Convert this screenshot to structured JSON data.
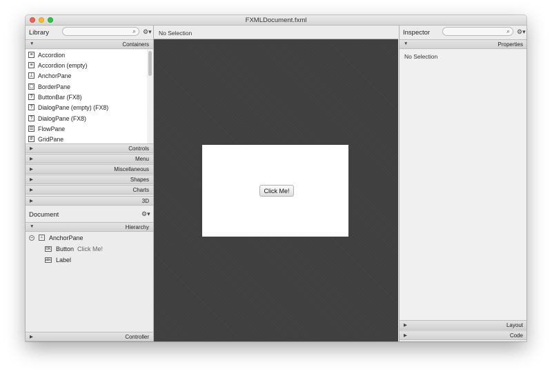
{
  "window": {
    "title": "FXMLDocument.fxml"
  },
  "library": {
    "title": "Library",
    "search_placeholder": "",
    "gear_icon": "gear-icon",
    "sections": {
      "containers": "Containers",
      "controls": "Controls",
      "menu": "Menu",
      "miscellaneous": "Miscellaneous",
      "shapes": "Shapes",
      "charts": "Charts",
      "three_d": "3D"
    },
    "items": [
      {
        "label": "Accordion",
        "icon": "accordion-icon"
      },
      {
        "label": "Accordion  (empty)",
        "icon": "accordion-icon"
      },
      {
        "label": "AnchorPane",
        "icon": "anchorpane-icon"
      },
      {
        "label": "BorderPane",
        "icon": "borderpane-icon"
      },
      {
        "label": "ButtonBar  (FX8)",
        "icon": "unknown-icon"
      },
      {
        "label": "DialogPane (empty)  (FX8)",
        "icon": "unknown-icon"
      },
      {
        "label": "DialogPane  (FX8)",
        "icon": "unknown-icon"
      },
      {
        "label": "FlowPane",
        "icon": "flowpane-icon"
      },
      {
        "label": "GridPane",
        "icon": "gridpane-icon"
      }
    ]
  },
  "document": {
    "title": "Document",
    "hierarchy_label": "Hierarchy",
    "controller_label": "Controller",
    "tree": [
      {
        "label": "AnchorPane",
        "sublabel": ""
      },
      {
        "label": "Button",
        "sublabel": "Click Me!"
      },
      {
        "label": "Label",
        "sublabel": ""
      }
    ]
  },
  "canvas": {
    "selection_text": "No Selection",
    "button_text": "Click Me!",
    "background_color": "#3f3f3f"
  },
  "inspector": {
    "title": "Inspector",
    "properties_label": "Properties",
    "layout_label": "Layout",
    "code_label": "Code",
    "no_selection": "No Selection"
  }
}
